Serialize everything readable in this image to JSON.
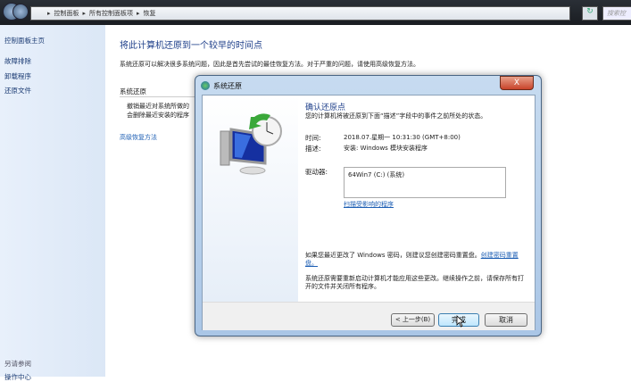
{
  "address": {
    "crumbs": [
      "控制面板",
      "所有控制面板项",
      "恢复"
    ],
    "search_placeholder": "搜索控"
  },
  "sidebar": {
    "items": [
      "控制面板主页",
      "故障排除",
      "卸载程序",
      "还原文件"
    ],
    "see_also": "另请参阅",
    "bottom_item": "操作中心"
  },
  "main": {
    "title": "将此计算机还原到一个较早的时间点",
    "desc": "系统还原可以解决很多系统问题，因此是首先尝试的最佳恢复方法。对于严重的问题，请使用高级恢复方法。",
    "section": "系统还原",
    "section_text1": "撤销最近对系统所做的",
    "section_text2": "会删除最近安装的程序",
    "advanced_link": "高级恢复方法"
  },
  "dialog": {
    "title": "系统还原",
    "close": "X",
    "heading": "确认还原点",
    "subtitle": "您的计算机将被还原到下面“描述”字段中的事件之前所处的状态。",
    "time_label": "时间:",
    "time_value": "2018.07.星期一 10:31:30 (GMT+8:00)",
    "desc_label": "描述:",
    "desc_value": "安装: Windows 模块安装程序",
    "drive_label": "驱动器:",
    "drive_value": "64Win7  (C:) (系统)",
    "scan_link": "扫描受影响的程序",
    "pw_text": "如果您最近更改了 Windows 密码，则建议您创建密码重置盘。",
    "pw_link": "创建密码重置盘。",
    "restart_text": "系统还原需要重新启动计算机才能应用这些更改。继续操作之前，请保存所有打开的文件并关闭所有程序。",
    "back": "< 上一步(B)",
    "finish": "完成",
    "cancel": "取消"
  }
}
